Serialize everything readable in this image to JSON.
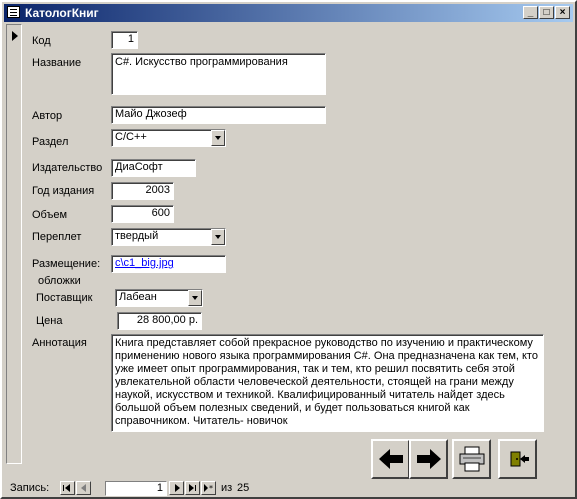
{
  "window": {
    "title": "КатологКниг",
    "minimize_glyph": "_",
    "maximize_glyph": "□",
    "close_glyph": "×"
  },
  "form": {
    "labels": {
      "code": "Код",
      "title": "Название",
      "author": "Автор",
      "section": "Раздел",
      "publisher": "Издательство",
      "year": "Год издания",
      "volume": "Объем",
      "binding": "Переплет",
      "location": "Размещение:",
      "cover": "обложки",
      "supplier": "Поставщик",
      "price": "Цена",
      "annotation": "Аннотация"
    },
    "values": {
      "code": "1",
      "title": "C#. Искусство программирования",
      "author": "Майо Джозеф",
      "section": "C/C++",
      "publisher": "ДиаСофт",
      "year": "2003",
      "volume": "600",
      "binding": "твердый",
      "location": "c\\c1_big.jpg",
      "supplier": "Лабеан",
      "price": "28 800,00 р.",
      "annotation": "Книга представляет собой прекрасное руководство по изучению и практическому применению нового языка программирования C#. Она предназначена как тем, кто уже имеет опыт программирования, так и тем, кто решил посвятить себя этой увлекательной области человеческой деятельности, стоящей на грани между наукой, искусством и техникой. Квалифицированный читатель найдет здесь большой объем полезных сведений, и будет пользоваться книгой как справочником. Читатель- новичок"
    }
  },
  "buttons": {
    "prev_icon": "arrow-left-icon",
    "next_icon": "arrow-right-icon",
    "print_icon": "printer-icon",
    "exit_icon": "exit-door-icon"
  },
  "statusbar": {
    "record_label": "Запись:",
    "current_record": "1",
    "of_label": "из",
    "total": "25"
  }
}
